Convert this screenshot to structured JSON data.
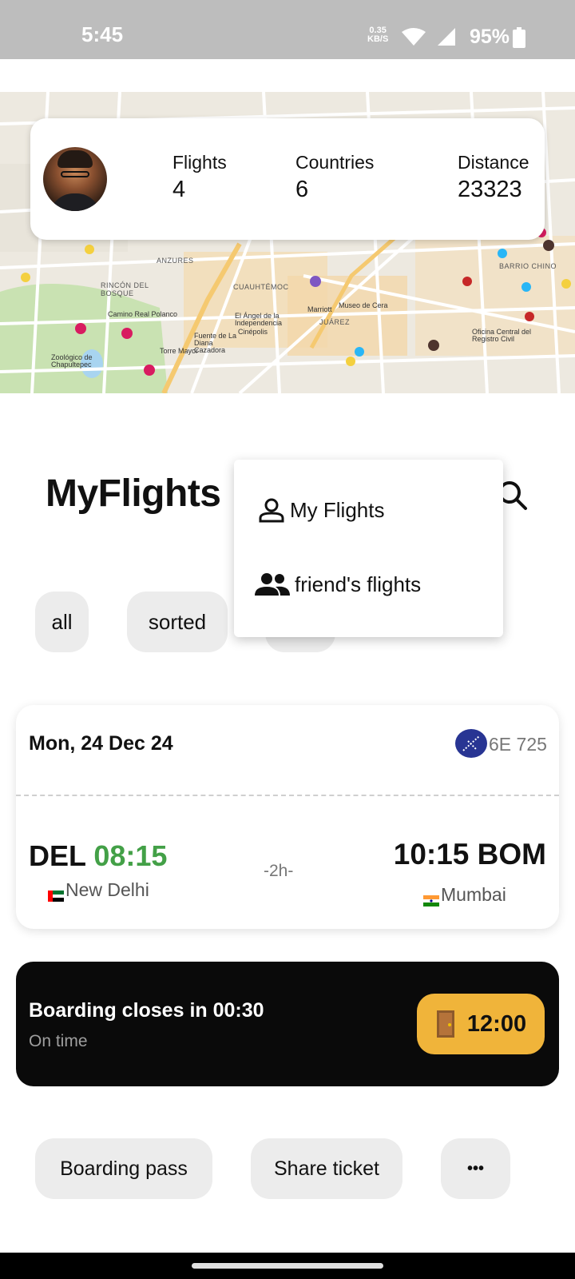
{
  "status_bar": {
    "time": "5:45",
    "net_speed_value": "0.35",
    "net_speed_unit": "KB/S",
    "battery": "95%"
  },
  "profile": {
    "flights_label": "Flights",
    "flights_value": "4",
    "countries_label": "Countries",
    "countries_value": "6",
    "distance_label": "Distance",
    "distance_value": "23323"
  },
  "map_labels": [
    "ANZURES",
    "RINCÓN DEL BOSQUE",
    "CUAUHTÉMOC",
    "JUÁREZ",
    "BARRIO CHINO",
    "El Ángel de la Independencia",
    "Museo de Cera",
    "Marriott",
    "Fuente de La Diana Cazadora",
    "Torre Mayor",
    "Zoológico de Chapultepec",
    "Camino Real Polanco",
    "Oficina Central del Registro Civil",
    "Cinépolis"
  ],
  "header": {
    "title": "MyFlights"
  },
  "filters": [
    "all",
    "sorted"
  ],
  "menu": {
    "items": [
      {
        "label": "My Flights",
        "icon": "person-icon"
      },
      {
        "label": "friend's flights",
        "icon": "people-icon"
      }
    ]
  },
  "flight": {
    "date": "Mon, 24 Dec 24",
    "flight_number": "6E 725",
    "origin_code": "DEL",
    "departure_time": "08:15",
    "origin_city": "New Delhi",
    "duration": "-2h-",
    "arrival_time": "10:15",
    "dest_code": "BOM",
    "dest_city": "Mumbai"
  },
  "boarding": {
    "title": "Boarding closes in 00:30",
    "status": "On time",
    "gate_time": "12:00"
  },
  "actions": {
    "boarding_pass": "Boarding pass",
    "share_ticket": "Share ticket",
    "more": "•••"
  },
  "colors": {
    "accent_green": "#43a047",
    "gate_yellow": "#f0b43a",
    "banner_black": "#0a0a0a",
    "chip_gray": "#ececec"
  }
}
